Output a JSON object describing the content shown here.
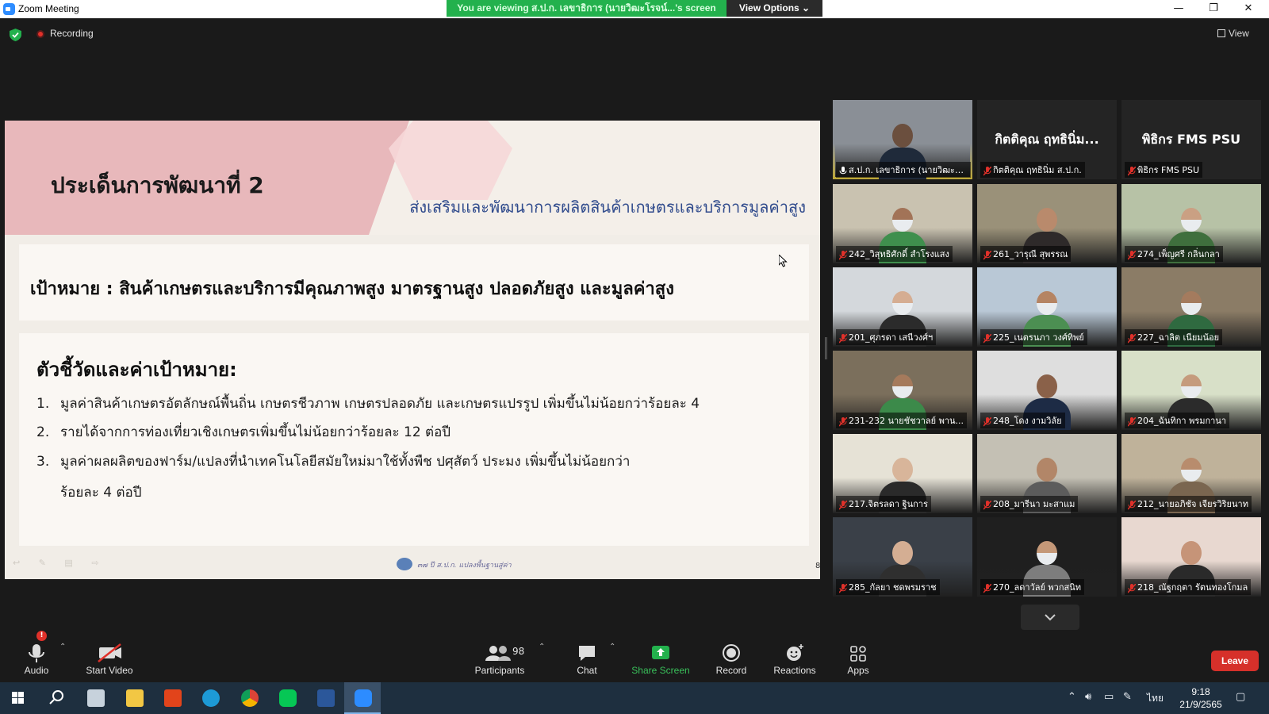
{
  "window": {
    "title": "Zoom Meeting",
    "viewing_banner": "You are viewing ส.ป.ก. เลขาธิการ (นายวิฒะโรจน์...'s screen",
    "view_options": "View Options ⌄",
    "minimize": "—",
    "maximize": "❐",
    "close": "✕"
  },
  "header": {
    "recording": "Recording",
    "view": "View"
  },
  "slide": {
    "heading": "ประเด็นการพัฒนาที่ 2",
    "subheading": "ส่งเสริมและพัฒนาการผลิตสินค้าเกษตรและบริการมูลค่าสูง",
    "goal": "เป้าหมาย : สินค้าเกษตรและบริการมีคุณภาพสูง มาตรฐานสูง ปลอดภัยสูง และมูลค่าสูง",
    "indicators_title": "ตัวชี้วัดและค่าเป้าหมาย:",
    "indicators": [
      {
        "num": "1.",
        "text": "มูลค่าสินค้าเกษตรอัตลักษณ์พื้นถิ่น เกษตรชีวภาพ เกษตรปลอดภัย และเกษตรแปรรูป เพิ่มขึ้นไม่น้อยกว่าร้อยละ 4",
        "cont": ""
      },
      {
        "num": "2.",
        "text": "รายได้จากการท่องเที่ยวเชิงเกษตรเพิ่มขึ้นไม่น้อยกว่าร้อยละ 12 ต่อปี",
        "cont": ""
      },
      {
        "num": "3.",
        "text": "มูลค่าผลผลิตของฟาร์ม/แปลงที่นำเทคโนโลยีสมัยใหม่มาใช้ทั้งพืช  ปศุสัตว์ ประมง เพิ่มขึ้นไม่น้อยกว่า",
        "cont": "ร้อยละ 4 ต่อปี"
      }
    ],
    "footer_text": "๓๗ ปี ส.ป.ก. แปลงพื้นฐานสู่ค่า",
    "page_number": "8"
  },
  "gallery": {
    "tiles": [
      {
        "name": "ส.ป.ก. เลขาธิการ (นายวิฒะโ...",
        "big": "",
        "video": true,
        "active": true,
        "bg": "#8a8f96",
        "skin": "#6b4f3e",
        "shirt": "#1f2a3a",
        "mask": false
      },
      {
        "name": "กิตติคุณ ฤทธินิ่ม ส.ป.ก.",
        "big": "กิตติคุณ ฤทธินิ่ม...",
        "video": false,
        "active": false
      },
      {
        "name": "พิธิกร FMS PSU",
        "big": "พิธิกร FMS PSU",
        "video": false,
        "active": false
      },
      {
        "name": "242_วิสุทธิศักดิ์ สำโรงแสง",
        "big": "",
        "video": true,
        "bg": "#c9c2b0",
        "skin": "#a27357",
        "shirt": "#3f8f4d",
        "mask": true
      },
      {
        "name": "261_วารุณี  สุพรรณ",
        "big": "",
        "video": true,
        "bg": "#9a9179",
        "skin": "#b98a6c",
        "shirt": "#2e2a2a",
        "mask": false
      },
      {
        "name": "274_เพ็ญศรี กลิ่นกลา",
        "big": "",
        "video": true,
        "bg": "#b7c2a6",
        "skin": "#caa083",
        "shirt": "#3f6f3d",
        "mask": true
      },
      {
        "name": "201_ศุภรดา เสนีวงศ์ฯ",
        "big": "",
        "video": true,
        "bg": "#d4d8dc",
        "skin": "#d5ad92",
        "shirt": "#2b2b2b",
        "mask": true
      },
      {
        "name": "225_เนตรนภา วงศ์ทิพย์",
        "big": "",
        "video": true,
        "bg": "#b9c8d6",
        "skin": "#b58463",
        "shirt": "#4c8f52",
        "mask": true
      },
      {
        "name": "227_ฉาลิต เนียมน้อย",
        "big": "",
        "video": true,
        "bg": "#8b7c66",
        "skin": "#a47b5e",
        "shirt": "#2f6a40",
        "mask": true
      },
      {
        "name": "231-232 นายชัชวาลย์ พาน...",
        "big": "",
        "video": true,
        "bg": "#7b6f5c",
        "skin": "#a57a5c",
        "shirt": "#3c8a4a",
        "mask": true
      },
      {
        "name": "248_โดง งามวิลัย",
        "big": "",
        "video": true,
        "bg": "#dedede",
        "skin": "#8a6149",
        "shirt": "#1d2b45",
        "mask": false
      },
      {
        "name": "204_ฉันทิกา พรมกานา",
        "big": "",
        "video": true,
        "bg": "#d8e0c8",
        "skin": "#c59b7d",
        "shirt": "#2b2b2b",
        "mask": true
      },
      {
        "name": "217.จิตรลดา ฐินการ",
        "big": "",
        "video": true,
        "bg": "#e6e2d6",
        "skin": "#d8b59a",
        "shirt": "#2a2a2a",
        "mask": false
      },
      {
        "name": "208_มารีนา มะสาแม",
        "big": "",
        "video": true,
        "bg": "#c4c0b4",
        "skin": "#b28668",
        "shirt": "#5c5c5c",
        "mask": false
      },
      {
        "name": "212_นายอภิชัจ เจียรวิริยนาท",
        "big": "",
        "video": true,
        "bg": "#bfb29a",
        "skin": "#b88c6d",
        "shirt": "#7a6650",
        "mask": true
      },
      {
        "name": "285_กัลยา ชดพรมราช",
        "big": "",
        "video": true,
        "bg": "#3a4048",
        "skin": "#d4ae93",
        "shirt": "#2f2f2f",
        "mask": false
      },
      {
        "name": "270_ลดาวัลย์ พวกสนิท",
        "big": "",
        "video": true,
        "bg": "#1f1f1f",
        "skin": "#c49878",
        "shirt": "#7d7d7d",
        "mask": true
      },
      {
        "name": "218_ณัฐกฤตา รัตนทองโกมล",
        "big": "",
        "video": true,
        "bg": "#e8d8d0",
        "skin": "#c69478",
        "shirt": "#2a2a2a",
        "mask": false
      }
    ]
  },
  "toolbar": {
    "audio": "Audio",
    "audio_badge": "!",
    "start_video": "Start Video",
    "participants": "Participants",
    "participants_count": "98",
    "chat": "Chat",
    "share_screen": "Share Screen",
    "record": "Record",
    "reactions": "Reactions",
    "apps": "Apps",
    "leave": "Leave"
  },
  "taskbar": {
    "language": "ไทย",
    "time": "9:18",
    "date": "21/9/2565"
  },
  "colors": {
    "share_green": "#23b14d",
    "leave_red": "#d6302a",
    "active_speaker": "#ffe14a"
  }
}
